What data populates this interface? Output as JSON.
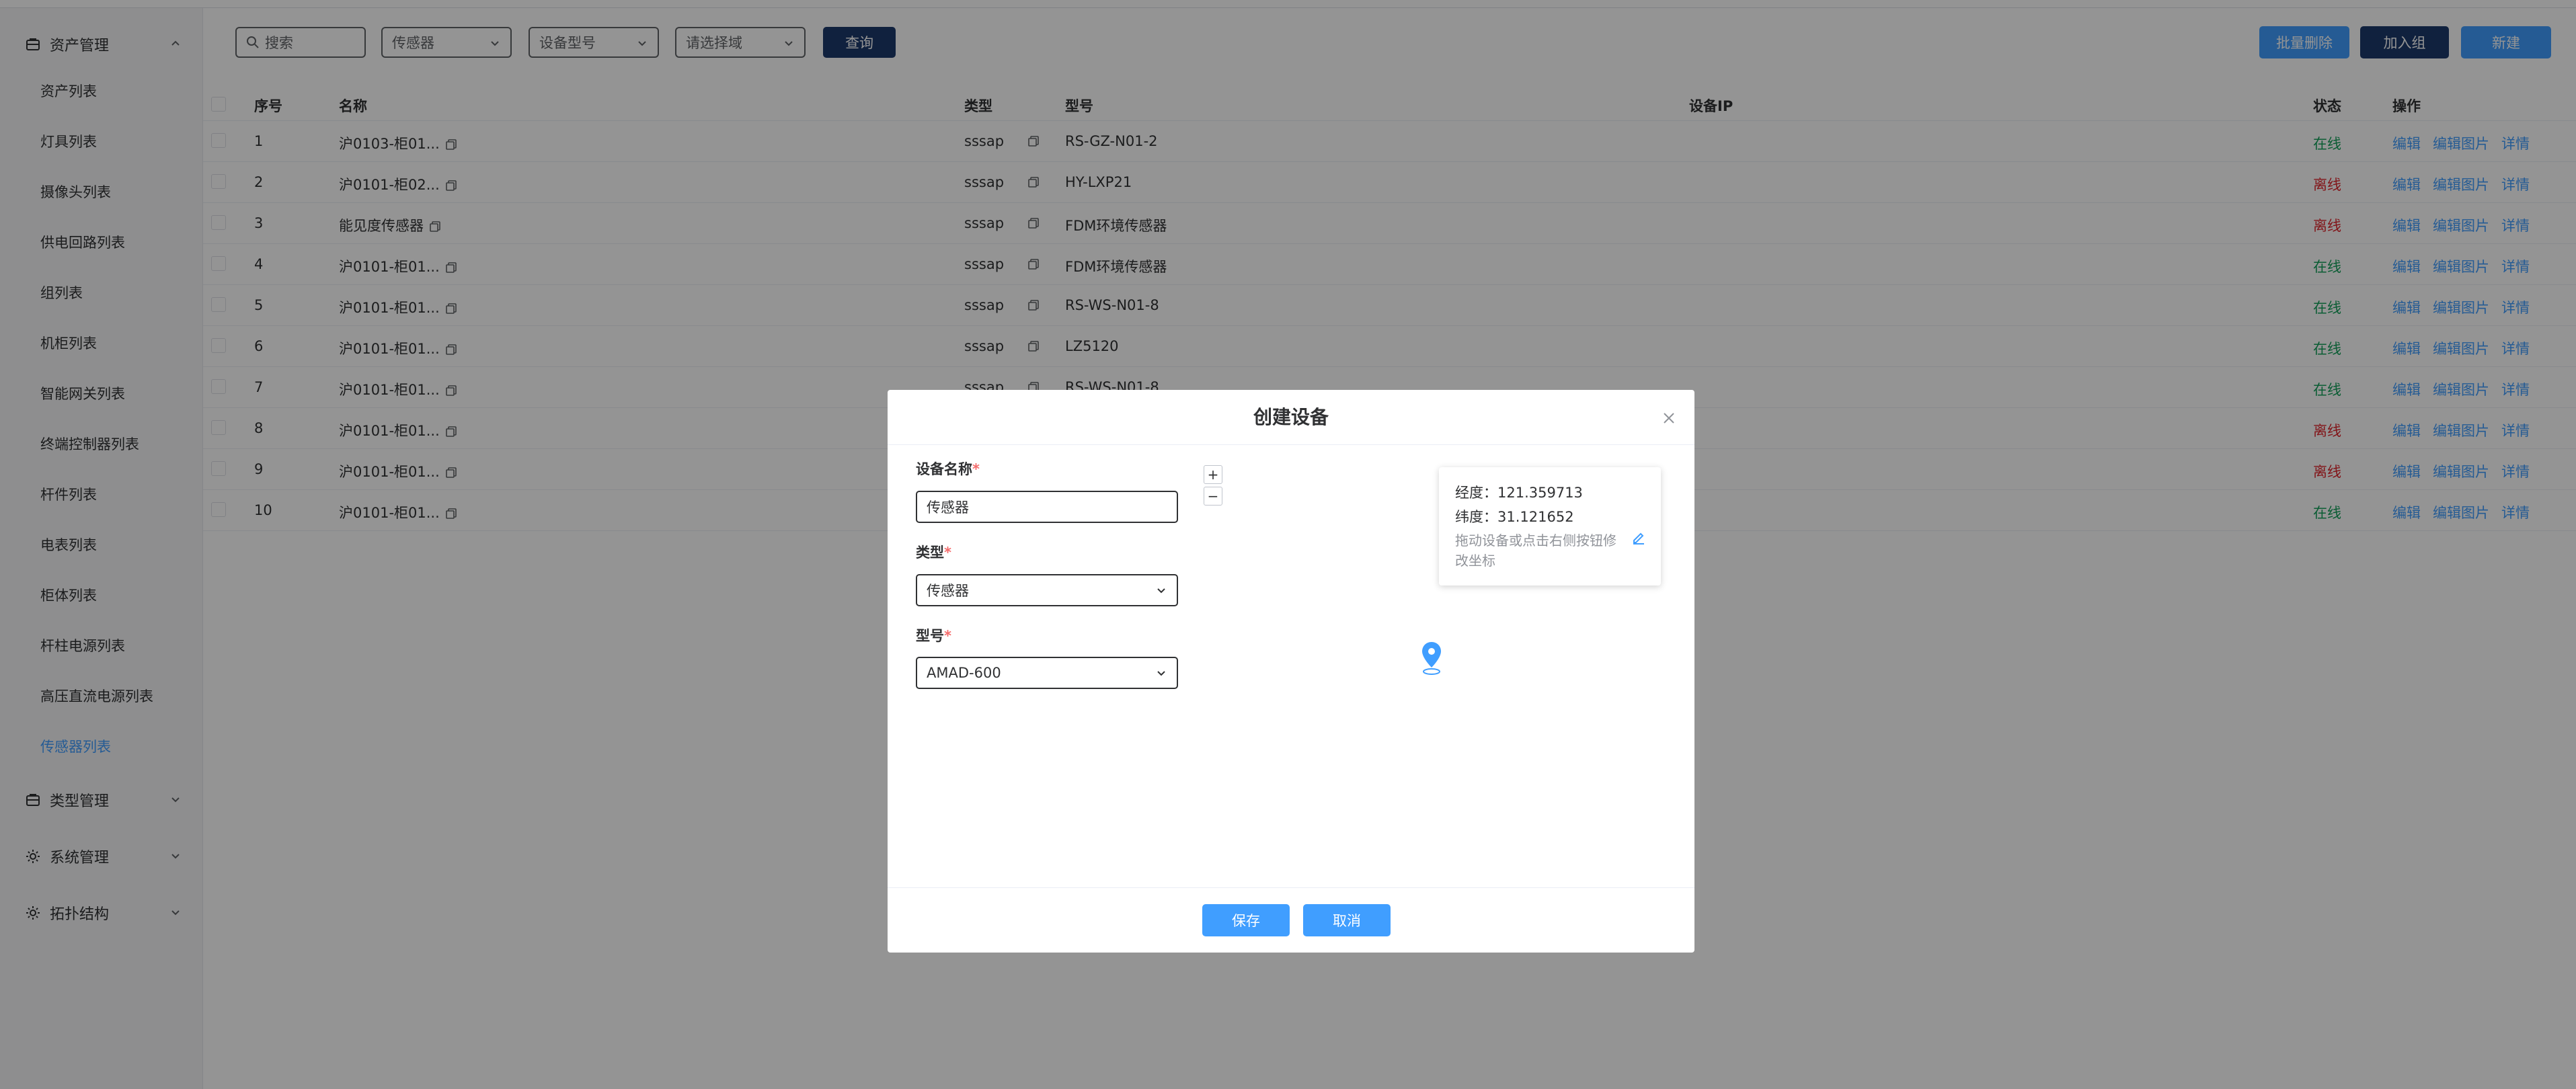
{
  "sidebar": {
    "groups": [
      {
        "label": "资产管理",
        "icon": "asset-icon"
      },
      {
        "label": "类型管理",
        "icon": "type-icon"
      },
      {
        "label": "系统管理",
        "icon": "settings-icon"
      },
      {
        "label": "拓扑结构",
        "icon": "topology-icon"
      }
    ],
    "items": [
      "资产列表",
      "灯具列表",
      "摄像头列表",
      "供电回路列表",
      "组列表",
      "机柜列表",
      "智能网关列表",
      "终端控制器列表",
      "杆件列表",
      "电表列表",
      "柜体列表",
      "杆柱电源列表",
      "高压直流电源列表",
      "传感器列表"
    ],
    "active_item": "传感器列表"
  },
  "toolbar": {
    "search_placeholder": "搜索",
    "filter_type": "传感器",
    "filter_model": "设备型号",
    "filter_area": "请选择域",
    "query_label": "查询",
    "batch_delete_label": "批量删除",
    "join_group_label": "加入组",
    "new_label": "新建"
  },
  "table": {
    "headers": {
      "index": "序号",
      "name": "名称",
      "type": "类型",
      "model": "型号",
      "ip": "设备IP",
      "status": "状态",
      "ops": "操作"
    },
    "rows": [
      {
        "index": "1",
        "name": "沪0103-柜01...",
        "type": "sssap",
        "model": "RS-GZ-N01-2",
        "status": "在线"
      },
      {
        "index": "2",
        "name": "沪0101-柜02...",
        "type": "sssap",
        "model": "HY-LXP21",
        "status": "离线"
      },
      {
        "index": "3",
        "name": "能见度传感器",
        "type": "sssap",
        "model": "FDM环境传感器",
        "status": "离线"
      },
      {
        "index": "4",
        "name": "沪0101-柜01...",
        "type": "sssap",
        "model": "FDM环境传感器",
        "status": "在线"
      },
      {
        "index": "5",
        "name": "沪0101-柜01...",
        "type": "sssap",
        "model": "RS-WS-N01-8",
        "status": "在线"
      },
      {
        "index": "6",
        "name": "沪0101-柜01...",
        "type": "sssap",
        "model": "LZ5120",
        "status": "在线"
      },
      {
        "index": "7",
        "name": "沪0101-柜01...",
        "type": "sssap",
        "model": "RS-WS-N01-8",
        "status": "在线"
      },
      {
        "index": "8",
        "name": "沪0101-柜01...",
        "type": "",
        "model": "",
        "status": "离线"
      },
      {
        "index": "9",
        "name": "沪0101-柜01...",
        "type": "",
        "model": "",
        "status": "离线"
      },
      {
        "index": "10",
        "name": "沪0101-柜01...",
        "type": "",
        "model": "",
        "status": "在线"
      }
    ],
    "ops": {
      "edit": "编辑",
      "edit_image": "编辑图片",
      "detail": "详情"
    }
  },
  "modal": {
    "title": "创建设备",
    "name_label": "设备名称",
    "name_value": "传感器",
    "type_label": "类型",
    "type_value": "传感器",
    "model_label": "型号",
    "model_value": "AMAD-600",
    "required_mark": "*",
    "zoom_in": "+",
    "zoom_out": "−",
    "longitude_label": "经度：",
    "longitude_value": "121.359713",
    "latitude_label": "纬度：",
    "latitude_value": "31.121652",
    "coord_hint": "拖动设备或点击右侧按钮修改坐标",
    "save_label": "保存",
    "cancel_label": "取消"
  },
  "colors": {
    "primary": "#409eff",
    "dark_button": "#1d3a6b",
    "online": "#13a05a",
    "offline": "#e0252b"
  }
}
